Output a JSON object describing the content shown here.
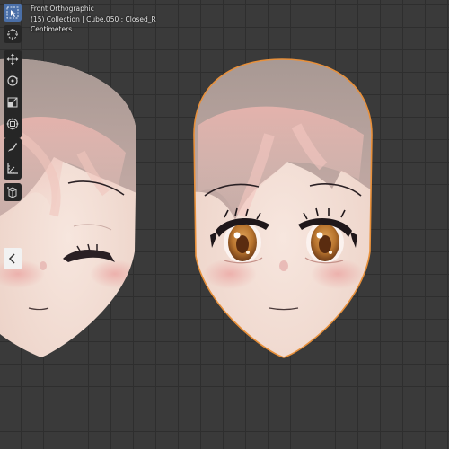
{
  "viewport": {
    "view_name": "Front Orthographic",
    "collection_line": "(15) Collection | Cube.050 : Closed_R",
    "units": "Centimeters"
  },
  "toolbar": {
    "tools": [
      {
        "name": "select-box-icon",
        "active": true
      },
      {
        "name": "cursor-icon",
        "active": false
      },
      {
        "name": "move-icon",
        "active": false
      },
      {
        "name": "rotate-icon",
        "active": false
      },
      {
        "name": "scale-icon",
        "active": false
      },
      {
        "name": "transform-icon",
        "active": false
      },
      {
        "name": "annotate-icon",
        "active": false
      },
      {
        "name": "measure-icon",
        "active": false
      },
      {
        "name": "add-cube-icon",
        "active": false
      }
    ]
  },
  "sidebar_toggle": {
    "icon": "chevron-left-icon"
  },
  "colors": {
    "grid_bg": "#3a3a3a",
    "grid_line": "#2e2e2e",
    "selection_outline": "#e8903a",
    "skin": "#f2dcd3",
    "hair": "#a89a94",
    "iris": "#b8742e"
  }
}
